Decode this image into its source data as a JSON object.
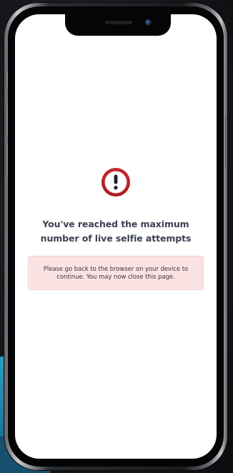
{
  "error": {
    "heading": "You've reached the maximum number of live selfie attempts",
    "message": "Please go back to the browser on your device to continue. You may now close this page."
  },
  "icons": {
    "alert": "exclamation-circle-icon"
  },
  "colors": {
    "alert_red": "#c8262b",
    "notice_background": "#fbe3e3",
    "heading_text": "#3b4150",
    "screen_background": "#ffffff"
  }
}
